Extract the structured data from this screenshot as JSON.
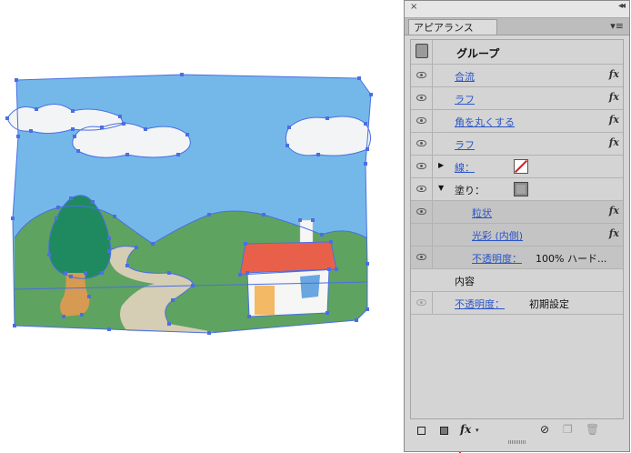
{
  "panel": {
    "close_glyph": "×",
    "collapse_glyph": "◂◂",
    "tab_label": "アピアランス",
    "menu_glyph": "▾≡",
    "group_label": "グループ",
    "effects": [
      {
        "label": "合流",
        "fx": "fx"
      },
      {
        "label": "ラフ",
        "fx": "fx"
      },
      {
        "label": "角を丸くする",
        "fx": "fx"
      },
      {
        "label": "ラフ",
        "fx": "fx"
      }
    ],
    "stroke": {
      "label": "線：",
      "triangle": "▶"
    },
    "fill": {
      "label": "塗り：",
      "triangle": "▼",
      "sub_effects": [
        {
          "label": "粒状",
          "fx": "fx"
        },
        {
          "label": "光彩 (内側)",
          "fx": "fx"
        }
      ],
      "opacity_label": "不透明度：",
      "opacity_value": "100% ハード..."
    },
    "content_label": "内容",
    "bottom_opacity_label": "不透明度：",
    "bottom_opacity_value": "初期設定"
  },
  "footer": {
    "add_stroke_icon": "new-stroke-icon",
    "add_fill_icon": "new-fill-icon",
    "fx_label": "fx",
    "clear_icon": "clear-appearance-icon",
    "duplicate_icon": "duplicate-icon",
    "delete_icon": "trash-icon"
  },
  "colors": {
    "sky": "#74b8ea",
    "hill": "#5fa360",
    "tree": "#1f8a5f",
    "trunk": "#d79a52",
    "path": "#d5cdb4",
    "roof": "#e8604a",
    "house": "#f6f6f4",
    "door": "#f3b964",
    "window": "#6aa6e0",
    "selection": "#4a6fe3",
    "link": "#2a55c8"
  }
}
